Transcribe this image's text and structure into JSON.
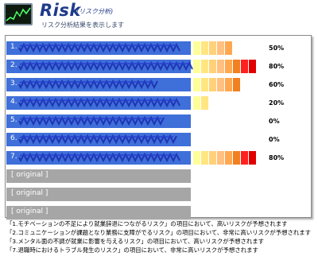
{
  "header": {
    "title": "Risk",
    "subtitle": "(リスク分析)",
    "description": "リスク分析結果を表示します"
  },
  "rows": [
    {
      "label": "1.",
      "type": "blue",
      "level": 5,
      "percent": "50%"
    },
    {
      "label": "2.",
      "type": "blue",
      "level": 8,
      "percent": "80%"
    },
    {
      "label": "3.",
      "type": "blue",
      "level": 6,
      "percent": "60%"
    },
    {
      "label": "4.",
      "type": "blue",
      "level": 2,
      "percent": "20%"
    },
    {
      "label": "5.",
      "type": "blue",
      "level": 0,
      "percent": "0%"
    },
    {
      "label": "6.",
      "type": "blue",
      "level": 0,
      "percent": "0%"
    },
    {
      "label": "7.",
      "type": "blue",
      "level": 8,
      "percent": "80%"
    },
    {
      "label": "[      original      ]",
      "type": "gray"
    },
    {
      "label": "[      original      ]",
      "type": "gray"
    },
    {
      "label": "[      original      ]",
      "type": "gray"
    }
  ],
  "meter_colors": [
    "#ffff99",
    "#ffe680",
    "#ffd27a",
    "#ffc080",
    "#ffa850",
    "#f08020",
    "#ff2020",
    "#e00000"
  ],
  "row_blue_color": "#3f6fd9",
  "row_gray_color": "#a6a6a6",
  "legend": [
    "「1.モチベーションの不足により就業辞退につながるリスク」の項目において、高いリスクが予想されます",
    "「2.コミュニケーションが課題となり業務に支障がでるリスク」の項目において、非常に高いリスクが予想されます",
    "「3.メンタル面の不調が就業に影響を与えるリスク」の項目において、高いリスクが予想されます",
    "「7.退職時におけるトラブル発生のリスク」の項目において、非常に高いリスクが予想されます"
  ]
}
